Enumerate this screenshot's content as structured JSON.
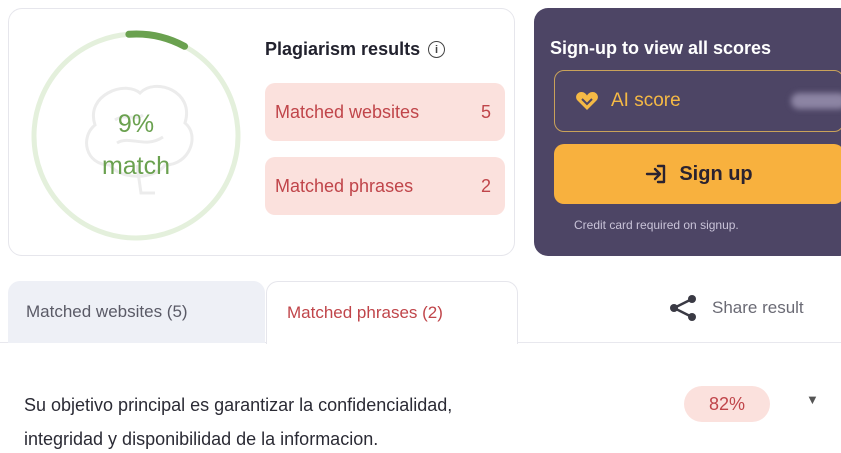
{
  "summary": {
    "match_percent": "9%",
    "match_label": "match",
    "match_fraction": 0.09
  },
  "results": {
    "title": "Plagiarism results",
    "websites_label": "Matched websites",
    "websites_count": "5",
    "phrases_label": "Matched phrases",
    "phrases_count": "2"
  },
  "promo": {
    "title": "Sign-up to view all scores",
    "ai_score_label": "AI score",
    "signup_label": "Sign up",
    "note": "Credit card required on signup."
  },
  "tabs": [
    {
      "label": "Matched websites (5)",
      "active": false
    },
    {
      "label": "Matched phrases (2)",
      "active": true
    }
  ],
  "share_label": "Share result",
  "phrases": [
    {
      "line1": "Su objetivo principal es garantizar la confidencialidad,",
      "line2": "integridad y disponibilidad de la informacion.",
      "percent": "82%"
    }
  ],
  "colors": {
    "ring": "#6aa14f",
    "ring_track": "#e4f0dc",
    "promo_bg": "#4d4565",
    "accent_orange": "#f8b13e",
    "match_red": "#c0454a",
    "pill_bg": "#fbe1dd"
  }
}
